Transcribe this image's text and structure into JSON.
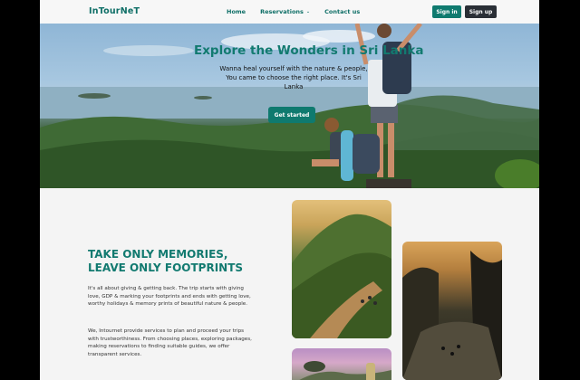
{
  "nav": {
    "logo": "InTourNeT",
    "links": [
      {
        "label": "Home"
      },
      {
        "label": "Reservations"
      },
      {
        "label": "Contact us"
      }
    ],
    "signin_label": "Sign in",
    "signup_label": "Sign up"
  },
  "hero": {
    "title": "Explore the Wonders in Sri Lanka",
    "subtitle": "Wanna heal yourself with the nature & people, You came to choose the right place. It's Sri Lanka",
    "cta_label": "Get started"
  },
  "about": {
    "tagline": "TAKE ONLY MEMORIES, LEAVE ONLY FOOTPRINTS",
    "paragraph1": "It's all about giving & getting back. The trip starts with giving love, GDP & marking your footprints and ends with getting love, worthy holidays & memory prints of beautiful nature & people.",
    "paragraph2": "We, Intournet provide services to plan and proceed your trips with trustworthiness. From choosing places, exploring packages, making reservations to finding suitable guides, we offer transparent services."
  },
  "colors": {
    "brand": "#0f7a6f",
    "dark_button": "#2a2f36"
  }
}
